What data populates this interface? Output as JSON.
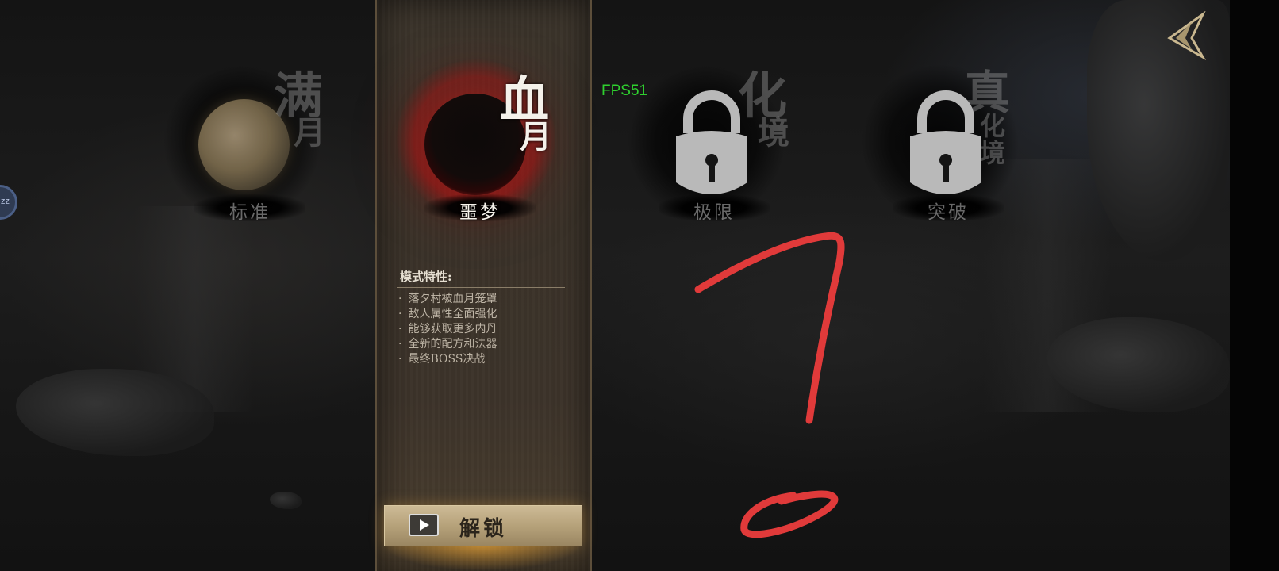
{
  "hud": {
    "fps": "FPS51",
    "side_bubble": "zz"
  },
  "modes": [
    {
      "id": "standard",
      "moon_chars": [
        "满",
        "月"
      ],
      "label": "标准",
      "locked": false,
      "selected": false
    },
    {
      "id": "nightmare",
      "moon_chars": [
        "血",
        "月"
      ],
      "label": "噩梦",
      "locked": false,
      "selected": true
    },
    {
      "id": "extreme",
      "moon_chars": [
        "化",
        "境"
      ],
      "label": "极限",
      "locked": true,
      "selected": false
    },
    {
      "id": "breakthrough",
      "moon_chars": [
        "真",
        "化",
        "境"
      ],
      "label": "突破",
      "locked": true,
      "selected": false
    }
  ],
  "details": {
    "title": "模式特性:",
    "features": [
      "落夕村被血月笼罩",
      "敌人属性全面强化",
      "能够获取更多内丹",
      "全新的配方和法器",
      "最终BOSS决战"
    ]
  },
  "unlock_button": {
    "label": "解锁",
    "icon": "video-play-icon"
  },
  "back_button": {
    "icon": "back-arrow-icon"
  },
  "colors": {
    "fps": "#2fd02f",
    "scribble": "#e03a3a",
    "blood": "#c81e1e"
  }
}
